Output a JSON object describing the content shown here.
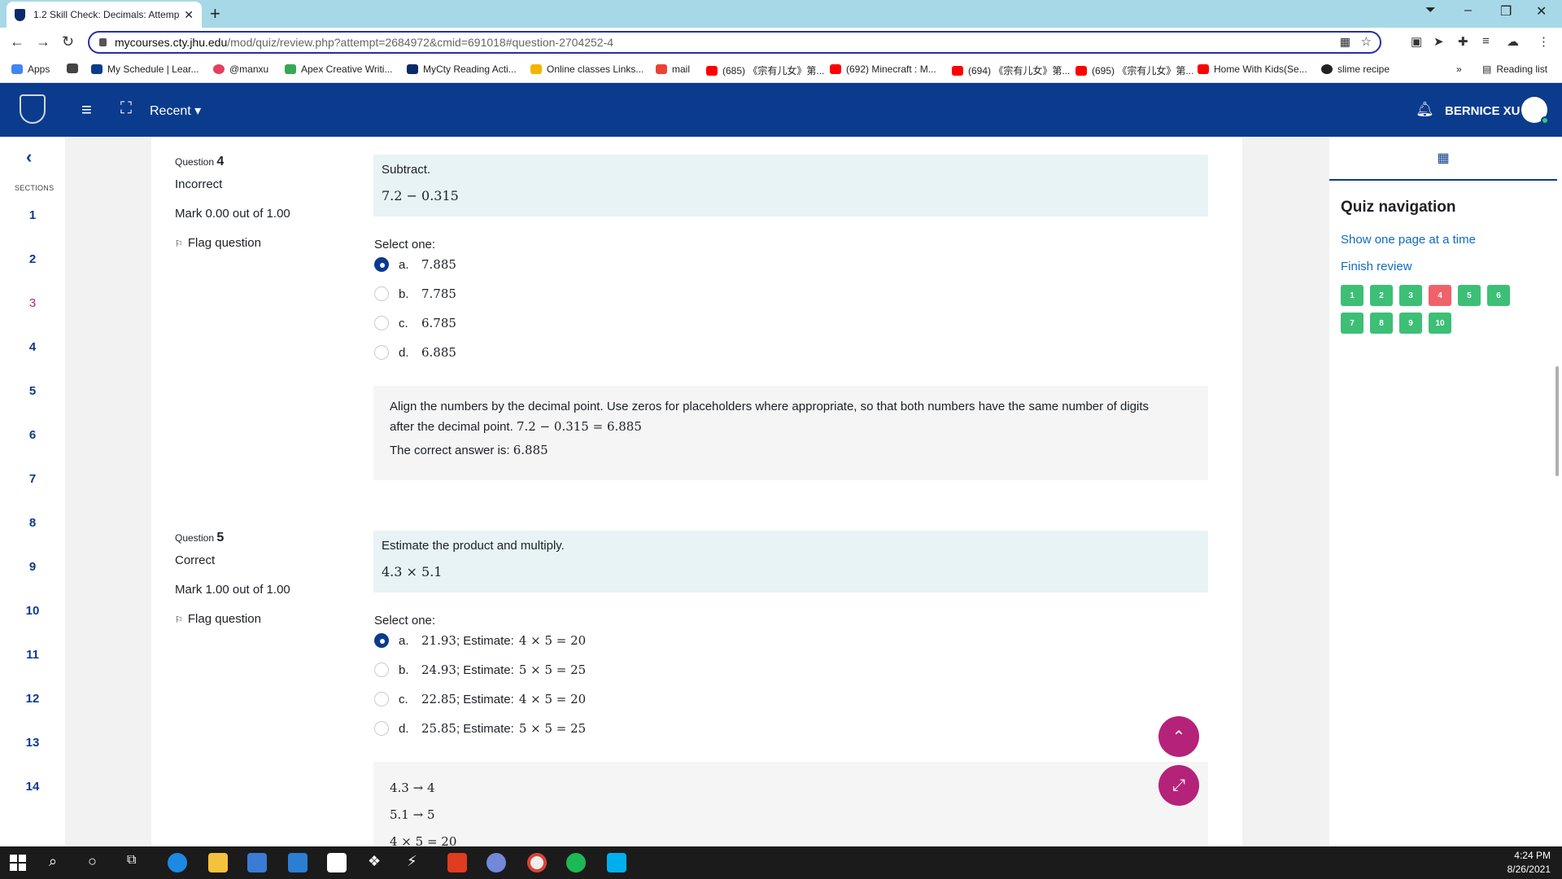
{
  "browser": {
    "tab_title": "1.2 Skill Check: Decimals: Attemp",
    "url_host": "mycourses.cty.jhu.edu",
    "url_path": "/mod/quiz/review.php?attempt=2684972&cmid=691018#question-2704252-4",
    "bookmarks": [
      {
        "label": "Apps",
        "color": "#4285f4"
      },
      {
        "label": "",
        "color": "#444444"
      },
      {
        "label": "My Schedule | Lear...",
        "color": "#0b3b8c"
      },
      {
        "label": "@manxu",
        "color": "#e4405f"
      },
      {
        "label": "Apex Creative Writi...",
        "color": "#34a853"
      },
      {
        "label": "MyCty Reading Acti...",
        "color": "#0a2a6b"
      },
      {
        "label": "Online classes Links...",
        "color": "#f4b400"
      },
      {
        "label": "mail",
        "color": "#ea4335"
      },
      {
        "label": "(685) 《宗有儿女》第...",
        "color": "#ff0000"
      },
      {
        "label": "(692) Minecraft : M...",
        "color": "#ff0000"
      },
      {
        "label": "(694) 《宗有儿女》第...",
        "color": "#ff0000"
      },
      {
        "label": "(695) 《宗有儿女》第...",
        "color": "#ff0000"
      },
      {
        "label": "Home With Kids(Se...",
        "color": "#ff0000"
      },
      {
        "label": "slime recipe",
        "color": "#222222"
      }
    ],
    "reading_list": "Reading list",
    "more_bookmarks": "»"
  },
  "header": {
    "recent_label": "Recent",
    "user_name": "BERNICE XU"
  },
  "sections": {
    "label": "SECTIONS",
    "items": [
      "1",
      "2",
      "3",
      "4",
      "5",
      "6",
      "7",
      "8",
      "9",
      "10",
      "11",
      "12",
      "13",
      "14"
    ],
    "highlight": "3"
  },
  "questions": [
    {
      "label": "Question",
      "number": "4",
      "state": "Incorrect",
      "mark": "Mark 0.00 out of 1.00",
      "flag": "Flag question",
      "prompt": "Subtract.",
      "expression": "7.2 − 0.315",
      "select_one": "Select one:",
      "options": [
        {
          "letter": "a.",
          "value": "7.885",
          "selected": true
        },
        {
          "letter": "b.",
          "value": "7.785",
          "selected": false
        },
        {
          "letter": "c.",
          "value": "6.785",
          "selected": false
        },
        {
          "letter": "d.",
          "value": "6.885",
          "selected": false
        }
      ],
      "feedback_line1": "Align the numbers by the decimal point. Use zeros for placeholders where appropriate, so that both numbers have the same number of digits",
      "feedback_line2_text": "after the decimal point.",
      "feedback_line2_math": "7.2 − 0.315 = 6.885",
      "correct_answer_text": "The correct answer is:",
      "correct_answer_value": "6.885"
    },
    {
      "label": "Question",
      "number": "5",
      "state": "Correct",
      "mark": "Mark 1.00 out of 1.00",
      "flag": "Flag question",
      "prompt": "Estimate the product and multiply.",
      "expression": "4.3 × 5.1",
      "select_one": "Select one:",
      "options": [
        {
          "letter": "a.",
          "value": "21.93",
          "est_text": "; Estimate:",
          "est_math": "4 × 5 = 20",
          "selected": true
        },
        {
          "letter": "b.",
          "value": "24.93",
          "est_text": "; Estimate:",
          "est_math": "5 × 5 = 25",
          "selected": false
        },
        {
          "letter": "c.",
          "value": "22.85",
          "est_text": "; Estimate:",
          "est_math": "4 × 5 = 20",
          "selected": false
        },
        {
          "letter": "d.",
          "value": "25.85",
          "est_text": "; Estimate:",
          "est_math": "5 × 5 = 25",
          "selected": false
        }
      ],
      "feedback_lines": [
        "4.3 → 4",
        "5.1 → 5",
        "4 × 5 = 20"
      ]
    }
  ],
  "quiz_nav": {
    "title": "Quiz navigation",
    "show_one_page": "Show one page at a time",
    "finish_review": "Finish review",
    "buttons": [
      {
        "n": "1",
        "status": "correct"
      },
      {
        "n": "2",
        "status": "correct"
      },
      {
        "n": "3",
        "status": "correct"
      },
      {
        "n": "4",
        "status": "incorrect"
      },
      {
        "n": "5",
        "status": "correct"
      },
      {
        "n": "6",
        "status": "correct"
      },
      {
        "n": "7",
        "status": "correct"
      },
      {
        "n": "8",
        "status": "correct"
      },
      {
        "n": "9",
        "status": "correct"
      },
      {
        "n": "10",
        "status": "correct"
      }
    ],
    "colors": {
      "correct": "#3dbf76",
      "incorrect": "#f0626a"
    }
  },
  "taskbar": {
    "time": "4:24 PM",
    "date": "8/26/2021"
  }
}
